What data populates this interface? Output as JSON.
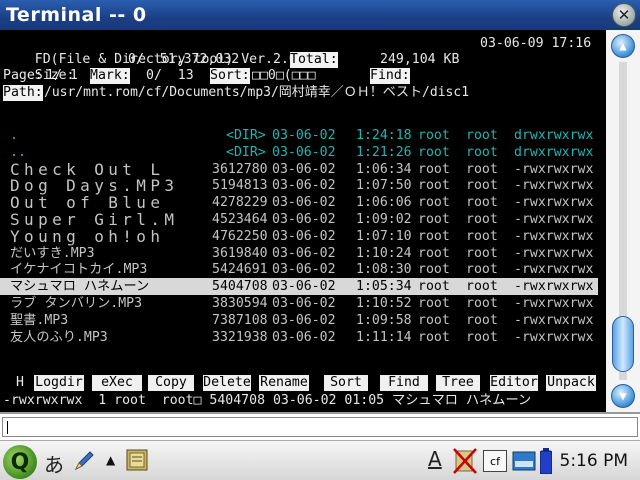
{
  "window": {
    "title": "Terminal -- 0",
    "close_glyph": "✕"
  },
  "fd": {
    "header": "FD(File & Directory tool) Ver.2.03b",
    "datetime": "03-06-09 17:16",
    "size_label": "Size:",
    "size_value": "0/  51,372,032",
    "total_label": "Total:",
    "total_value": "249,104 KB",
    "page_label": "Page:",
    "page_value": "1/ 1",
    "mark_label": "Mark:",
    "mark_value": "0/  13",
    "sort_label": "Sort:",
    "sort_value": "□□0□(□□□",
    "find_label": "Find:",
    "path_label": "Path:",
    "path_value": "/usr/mnt.rom/cf/Documents/mp3/岡村靖幸／ＯＨ！ベスト/disc1",
    "files": [
      {
        "name": ".",
        "size": "<DIR>",
        "date": "03-06-02",
        "time": "1:24:18",
        "owner": "root",
        "group": "root",
        "perm": "drwxrwxrwx",
        "style": "cyan"
      },
      {
        "name": "..",
        "size": "<DIR>",
        "date": "03-06-02",
        "time": "1:21:26",
        "owner": "root",
        "group": "root",
        "perm": "drwxrwxrwx",
        "style": "cyan"
      },
      {
        "name": "Check Out L",
        "size": "3612780",
        "date": "03-06-02",
        "time": "1:06:34",
        "owner": "root",
        "group": "root",
        "perm": "-rwxrwxrwx",
        "style": "big"
      },
      {
        "name": "Dog Days.MP3",
        "size": "5194813",
        "date": "03-06-02",
        "time": "1:07:50",
        "owner": "root",
        "group": "root",
        "perm": "-rwxrwxrwx",
        "style": "big"
      },
      {
        "name": "Out of Blue",
        "size": "4278229",
        "date": "03-06-02",
        "time": "1:06:06",
        "owner": "root",
        "group": "root",
        "perm": "-rwxrwxrwx",
        "style": "big"
      },
      {
        "name": "Super Girl.M",
        "size": "4523464",
        "date": "03-06-02",
        "time": "1:09:02",
        "owner": "root",
        "group": "root",
        "perm": "-rwxrwxrwx",
        "style": "big"
      },
      {
        "name": "Young oh!oh",
        "size": "4762250",
        "date": "03-06-02",
        "time": "1:07:10",
        "owner": "root",
        "group": "root",
        "perm": "-rwxrwxrwx",
        "style": "big"
      },
      {
        "name": "だいすき.MP3",
        "size": "3619840",
        "date": "03-06-02",
        "time": "1:10:24",
        "owner": "root",
        "group": "root",
        "perm": "-rwxrwxrwx",
        "style": "normal"
      },
      {
        "name": "イケナイコトカイ.MP3",
        "size": "5424691",
        "date": "03-06-02",
        "time": "1:08:30",
        "owner": "root",
        "group": "root",
        "perm": "-rwxrwxrwx",
        "style": "normal"
      },
      {
        "name": "マシュマロ ハネムーン",
        "size": "5404708",
        "date": "03-06-02",
        "time": "1:05:34",
        "owner": "root",
        "group": "root",
        "perm": "-rwxrwxrwx",
        "style": "selected"
      },
      {
        "name": "ラブ タンバリン.MP3",
        "size": "3830594",
        "date": "03-06-02",
        "time": "1:10:52",
        "owner": "root",
        "group": "root",
        "perm": "-rwxrwxrwx",
        "style": "normal"
      },
      {
        "name": "聖書.MP3",
        "size": "7387108",
        "date": "03-06-02",
        "time": "1:09:58",
        "owner": "root",
        "group": "root",
        "perm": "-rwxrwxrwx",
        "style": "normal"
      },
      {
        "name": "友人のふり.MP3",
        "size": "3321938",
        "date": "03-06-02",
        "time": "1:11:14",
        "owner": "root",
        "group": "root",
        "perm": "-rwxrwxrwx",
        "style": "normal"
      }
    ],
    "help_key": "H",
    "fkeys": [
      "Logdir",
      "eXec",
      "Copy",
      "Delete",
      "Rename",
      "Sort",
      "Find",
      "Tree",
      "Editor",
      "Unpack"
    ],
    "status_line": "-rwxrwxrwx  1 root  root□ 5404708 03-06-02 01:05 マシュマロ ハネムーン"
  },
  "taskbar": {
    "q_label": "Q",
    "ime_label": "あ",
    "pen_icon": "pen-icon",
    "up_arrow": "▲",
    "underline_a": "A",
    "cf_label": "cf",
    "clock": "5:16 PM"
  }
}
